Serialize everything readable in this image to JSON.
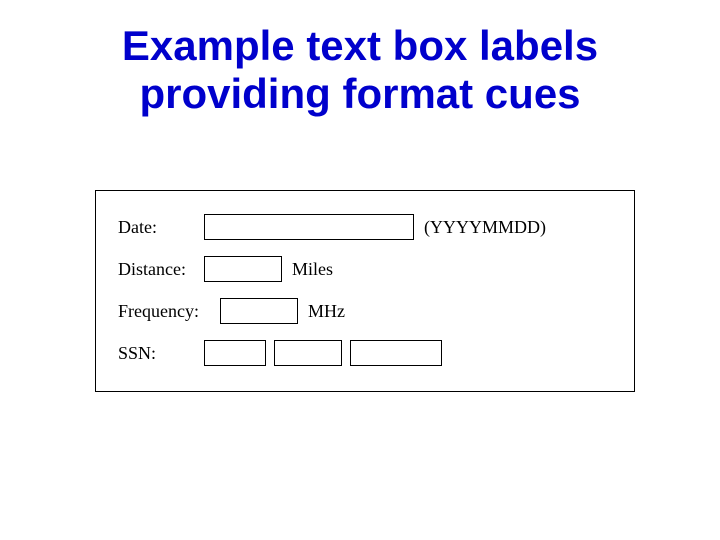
{
  "title_line1": "Example text box labels",
  "title_line2": "providing format cues",
  "rows": {
    "date": {
      "label": "Date:",
      "hint": "(YYYYMMDD)"
    },
    "distance": {
      "label": "Distance:",
      "unit": "Miles"
    },
    "frequency": {
      "label": "Frequency:",
      "unit": "MHz"
    },
    "ssn": {
      "label": "SSN:"
    }
  }
}
